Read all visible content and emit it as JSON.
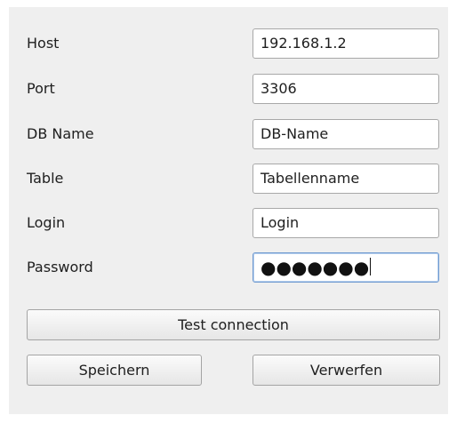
{
  "form": {
    "host": {
      "label": "Host",
      "value": "192.168.1.2"
    },
    "port": {
      "label": "Port",
      "value": "3306"
    },
    "db_name": {
      "label": "DB Name",
      "value": "DB-Name"
    },
    "table": {
      "label": "Table",
      "value": "Tabellenname"
    },
    "login": {
      "label": "Login",
      "value": "Login"
    },
    "password": {
      "label": "Password",
      "masked_value": "●●●●●●●"
    }
  },
  "buttons": {
    "test_connection": "Test connection",
    "save": "Speichern",
    "discard": "Verwerfen"
  }
}
